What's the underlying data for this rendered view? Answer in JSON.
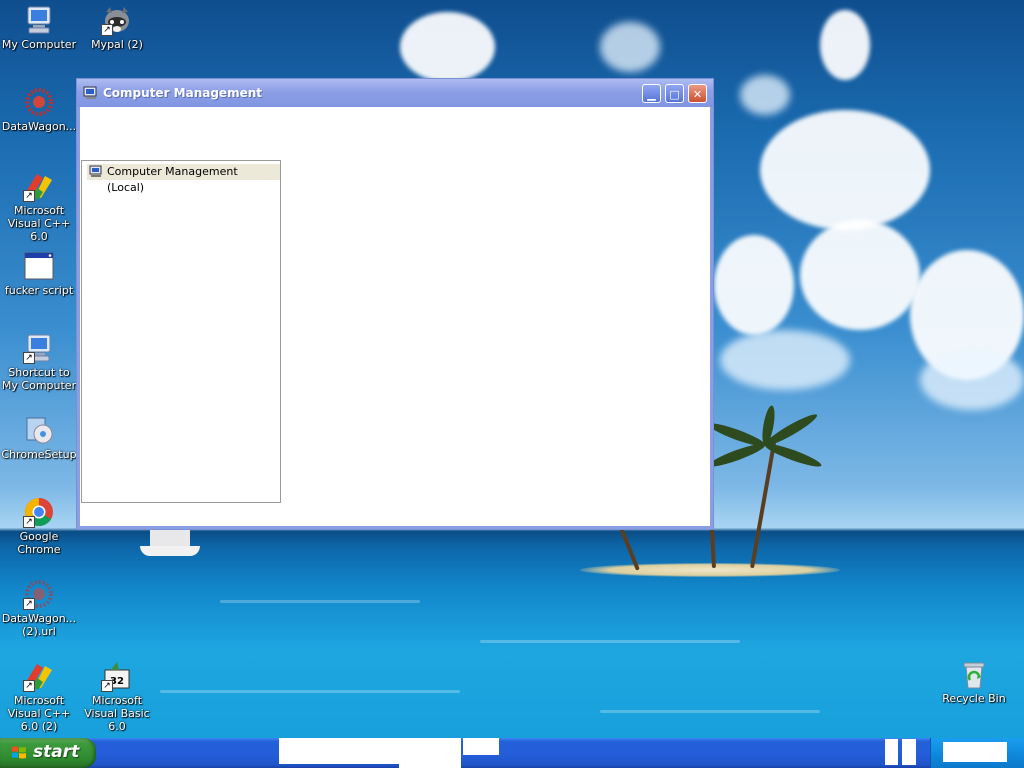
{
  "window": {
    "title": "Computer Management",
    "tree_root": "Computer Management (Local)"
  },
  "desktop": {
    "icons": {
      "my_computer": "My Computer",
      "mypal": "Mypal (2)",
      "datawagon": "DataWagon...",
      "vcpp": "Microsoft Visual C++ 6.0",
      "script": "fucker script",
      "shortcut_my_computer": "Shortcut to My Computer",
      "chromesetup": "ChromeSetup",
      "google_chrome": "Google Chrome",
      "datawagon_url": "DataWagon... (2).url",
      "vcpp2": "Microsoft Visual C++ 6.0 (2)",
      "vb6": "Microsoft Visual Basic 6.0",
      "recycle_bin": "Recycle Bin"
    }
  },
  "taskbar": {
    "start_label": "start"
  },
  "colors": {
    "taskbar_blue": "#245edb",
    "start_green": "#3c9a3c",
    "window_title_inactive": "#8c9fe7"
  }
}
